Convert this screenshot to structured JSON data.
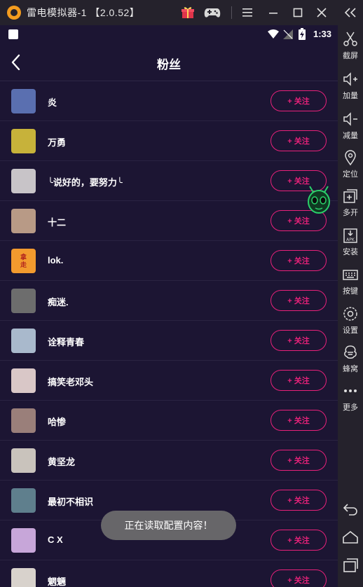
{
  "window": {
    "title": "雷电模拟器-1 【2.0.52】"
  },
  "status_bar": {
    "time": "1:33"
  },
  "header": {
    "title": "粉丝"
  },
  "followers": [
    {
      "name": "炎",
      "follow_label": "+ 关注",
      "avatar_color": "#5a6fb0"
    },
    {
      "name": "万勇",
      "follow_label": "+ 关注",
      "avatar_color": "#c7b23a"
    },
    {
      "name": "╰说好的，要努力╰",
      "follow_label": "+ 关注",
      "avatar_color": "#c8c4c8"
    },
    {
      "name": "十二",
      "follow_label": "+ 关注",
      "avatar_color": "#b89a86"
    },
    {
      "name": "lok.",
      "follow_label": "+ 关注",
      "avatar_color": "#f29a2e",
      "avatar_text": "拿 走"
    },
    {
      "name": "痴迷.",
      "follow_label": "+ 关注",
      "avatar_color": "#6d6d6d"
    },
    {
      "name": "诠释青春",
      "follow_label": "+ 关注",
      "avatar_color": "#a9b9cc"
    },
    {
      "name": "搞笑老邓头",
      "follow_label": "+ 关注",
      "avatar_color": "#d9c7c7"
    },
    {
      "name": "哈惨",
      "follow_label": "+ 关注",
      "avatar_color": "#9a7f7a"
    },
    {
      "name": "黄坚龙",
      "follow_label": "+ 关注",
      "avatar_color": "#c9c3bc"
    },
    {
      "name": "最初不相识",
      "follow_label": "+ 关注",
      "avatar_color": "#5f7f8d"
    },
    {
      "name": "C X",
      "follow_label": "+ 关注",
      "avatar_color": "#c7a6d9"
    },
    {
      "name": "魍魎",
      "follow_label": "+ 关注",
      "avatar_color": "#d8d2cc"
    }
  ],
  "toast": {
    "text": "正在读取配置内容！"
  },
  "sidebar": [
    {
      "label": "截屏",
      "icon": "scissors-icon"
    },
    {
      "label": "加量",
      "icon": "volume-up-icon"
    },
    {
      "label": "减量",
      "icon": "volume-down-icon"
    },
    {
      "label": "定位",
      "icon": "location-icon"
    },
    {
      "label": "多开",
      "icon": "multi-open-icon"
    },
    {
      "label": "安装",
      "icon": "apk-install-icon"
    },
    {
      "label": "按键",
      "icon": "keyboard-icon"
    },
    {
      "label": "设置",
      "icon": "gear-icon"
    },
    {
      "label": "蜂窝",
      "icon": "hive-icon"
    },
    {
      "label": "更多",
      "icon": "more-icon"
    }
  ],
  "colors": {
    "background": "#1c1533",
    "accent": "#e8217a",
    "toolbar": "#25222c"
  }
}
